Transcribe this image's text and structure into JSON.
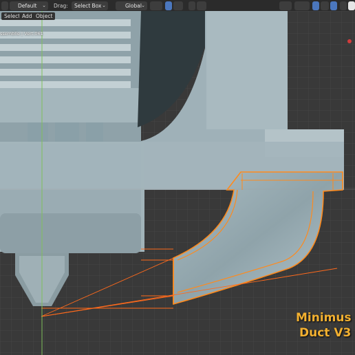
{
  "header": {
    "view_mode": "Default",
    "drag_label": "Drag:",
    "drag_value": "Select Box",
    "orientation": "Global"
  },
  "menubar": {
    "select": "Select",
    "add": "Add",
    "object": "Object"
  },
  "status_text": "ssemblie | Vert.061",
  "watermark": {
    "line1": "Minimus",
    "line2": "Duct V3"
  },
  "colors": {
    "background": "#3a3a3a",
    "model": "#9eb0b7",
    "selection": "#ff8a1c",
    "accent": "#4b77be",
    "watermark": "#f2b030"
  },
  "icons": [
    "cursor-icon",
    "transform-icon",
    "snap-icon",
    "proportional-icon",
    "visibility-icon",
    "gizmo-icon",
    "overlay-icon",
    "xray-icon",
    "shading-icon"
  ]
}
